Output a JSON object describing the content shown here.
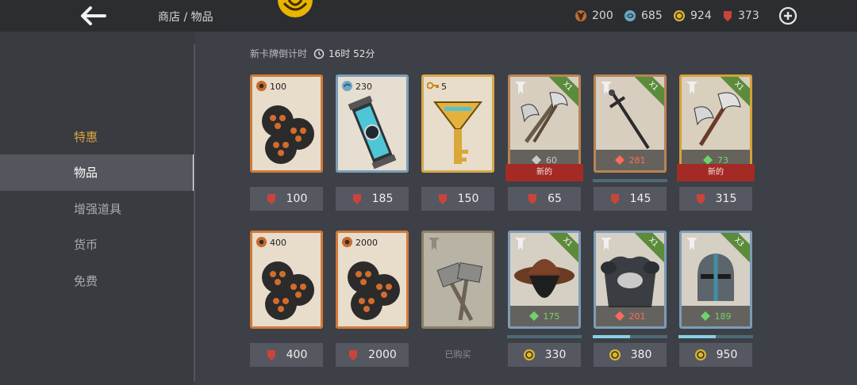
{
  "header": {
    "breadcrumb": "商店 / 物品",
    "currencies": [
      {
        "icon": "orange-token-icon",
        "value": "200",
        "color": "#d9793a"
      },
      {
        "icon": "blue-orb-icon",
        "value": "685",
        "color": "#7ab3cf"
      },
      {
        "icon": "gold-coin-icon",
        "value": "924",
        "color": "#d9b43a"
      },
      {
        "icon": "red-gem-icon",
        "value": "373",
        "color": "#c9443a"
      }
    ]
  },
  "sidebar": {
    "items": [
      {
        "label": "特惠"
      },
      {
        "label": "物品"
      },
      {
        "label": "增强道具"
      },
      {
        "label": "货币"
      },
      {
        "label": "免费"
      }
    ]
  },
  "timer": {
    "label": "新卡牌倒计时",
    "value": "16时 52分"
  },
  "row1": [
    {
      "kind": "orange",
      "qty": "100",
      "price": "100",
      "currency": "red-gem-icon"
    },
    {
      "kind": "blue",
      "qty": "230",
      "price": "185",
      "currency": "red-gem-icon"
    },
    {
      "kind": "gold",
      "qty": "5",
      "price": "150",
      "currency": "red-gem-icon"
    },
    {
      "kind": "equip",
      "tag": "X1",
      "level": "60",
      "level_color": "gray",
      "new": "新的",
      "price": "65",
      "currency": "red-gem-icon"
    },
    {
      "kind": "equip",
      "tag": "X1",
      "level": "281",
      "level_color": "red",
      "progress": 0,
      "price": "145",
      "currency": "red-gem-icon"
    },
    {
      "kind": "equip",
      "tag": "X1",
      "level": "73",
      "level_color": "green",
      "new": "新的",
      "price": "315",
      "currency": "red-gem-icon"
    }
  ],
  "row2": [
    {
      "kind": "orange",
      "qty": "400",
      "price": "400",
      "currency": "red-gem-icon"
    },
    {
      "kind": "orange",
      "qty": "2000",
      "price": "2000",
      "currency": "red-gem-icon"
    },
    {
      "kind": "bought",
      "label": "已购买"
    },
    {
      "kind": "equip",
      "tag": "X1",
      "level": "175",
      "level_color": "green",
      "progress": 0,
      "price": "330",
      "currency": "gold-coin-icon"
    },
    {
      "kind": "equip",
      "tag": "X1",
      "level": "201",
      "level_color": "red",
      "progress": 0.5,
      "price": "380",
      "currency": "gold-coin-icon"
    },
    {
      "kind": "equip",
      "tag": "X3",
      "level": "189",
      "level_color": "green",
      "progress": 0.5,
      "price": "950",
      "currency": "gold-coin-icon"
    }
  ]
}
